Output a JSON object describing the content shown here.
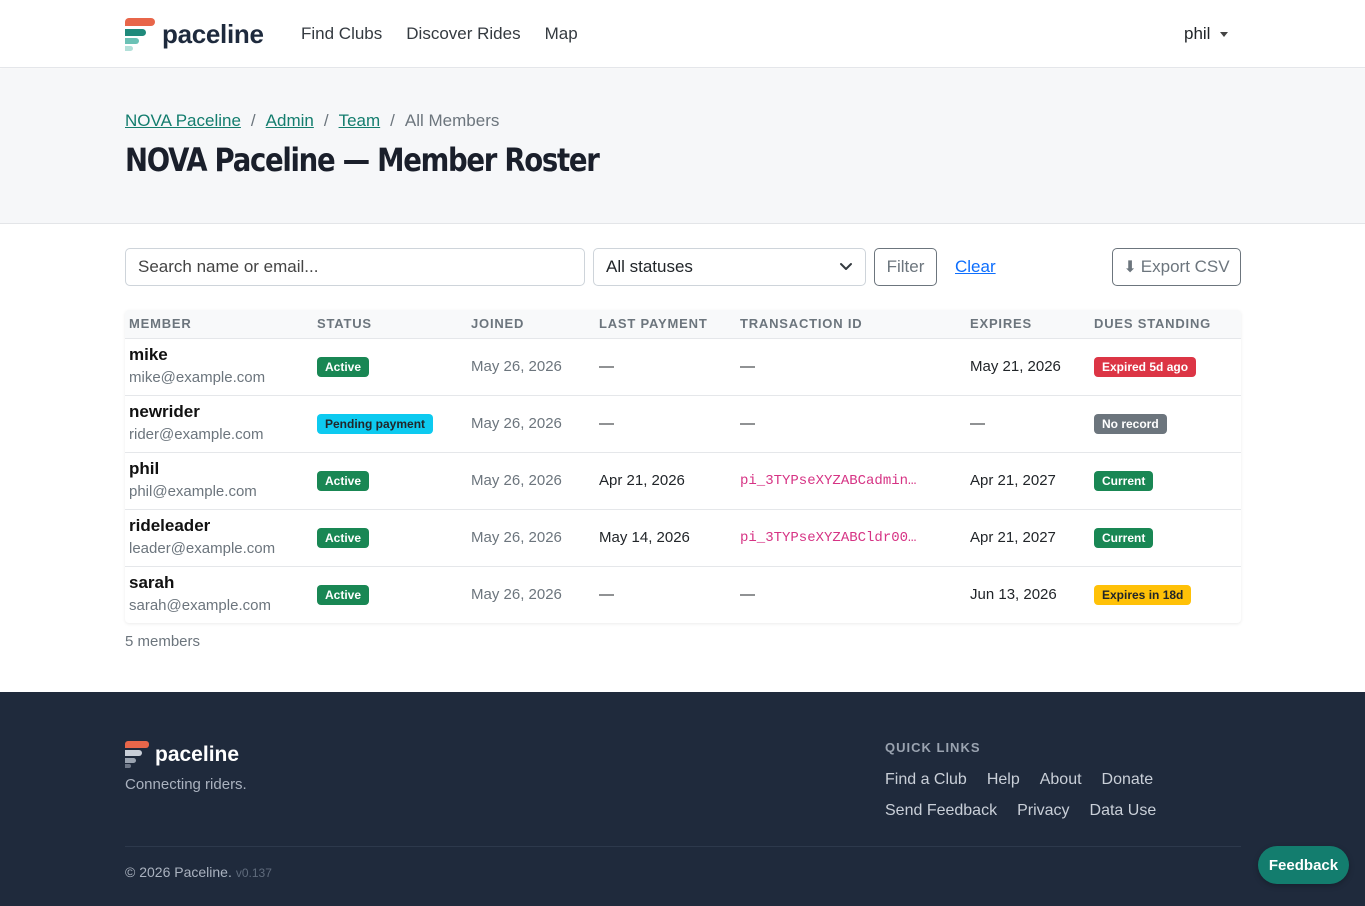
{
  "navbar": {
    "brand": "paceline",
    "links": [
      "Find Clubs",
      "Discover Rides",
      "Map"
    ],
    "user": "phil"
  },
  "breadcrumb": {
    "items": [
      "NOVA Paceline",
      "Admin",
      "Team"
    ],
    "current": "All Members"
  },
  "page": {
    "title": "NOVA Paceline — Member Roster"
  },
  "toolbar": {
    "search_placeholder": "Search name or email...",
    "status_selected": "All statuses",
    "filter_label": "Filter",
    "clear_label": "Clear",
    "export_icon": "⬇",
    "export_label": "Export CSV"
  },
  "table": {
    "headers": [
      "Member",
      "Status",
      "Joined",
      "Last Payment",
      "Transaction ID",
      "Expires",
      "Dues Standing"
    ],
    "rows": [
      {
        "name": "mike",
        "email": "mike@example.com",
        "status": "Active",
        "status_variant": "success",
        "joined": "May 26, 2026",
        "last_payment": "—",
        "transaction_id": "—",
        "expires": "May 21, 2026",
        "dues": "Expired 5d ago",
        "dues_variant": "danger"
      },
      {
        "name": "newrider",
        "email": "rider@example.com",
        "status": "Pending payment",
        "status_variant": "info",
        "joined": "May 26, 2026",
        "last_payment": "—",
        "transaction_id": "—",
        "expires": "—",
        "dues": "No record",
        "dues_variant": "secondary"
      },
      {
        "name": "phil",
        "email": "phil@example.com",
        "status": "Active",
        "status_variant": "success",
        "joined": "May 26, 2026",
        "last_payment": "Apr 21, 2026",
        "transaction_id": "pi_3TYPseXYZABCadmin…",
        "expires": "Apr 21, 2027",
        "dues": "Current",
        "dues_variant": "success"
      },
      {
        "name": "rideleader",
        "email": "leader@example.com",
        "status": "Active",
        "status_variant": "success",
        "joined": "May 26, 2026",
        "last_payment": "May 14, 2026",
        "transaction_id": "pi_3TYPseXYZABCldr00…",
        "expires": "Apr 21, 2027",
        "dues": "Current",
        "dues_variant": "success"
      },
      {
        "name": "sarah",
        "email": "sarah@example.com",
        "status": "Active",
        "status_variant": "success",
        "joined": "May 26, 2026",
        "last_payment": "—",
        "transaction_id": "—",
        "expires": "Jun 13, 2026",
        "dues": "Expires in 18d",
        "dues_variant": "warning"
      }
    ],
    "count_label": "5 members"
  },
  "footer": {
    "brand": "paceline",
    "tagline": "Connecting riders.",
    "quick_links_title": "QUICK LINKS",
    "links_row1": [
      "Find a Club",
      "Help",
      "About",
      "Donate"
    ],
    "links_row2": [
      "Send Feedback",
      "Privacy",
      "Data Use"
    ],
    "copyright": "© 2026 Paceline.",
    "version": "v0.137"
  },
  "feedback_button": "Feedback",
  "colors": {
    "brand_teal": "#137d6e",
    "brand_coral": "#e8664a",
    "footer_bg": "#1f2a3c",
    "success": "#198754",
    "info": "#0dcaf0",
    "danger": "#dc3545",
    "warning": "#ffc107",
    "secondary": "#6c757d"
  }
}
